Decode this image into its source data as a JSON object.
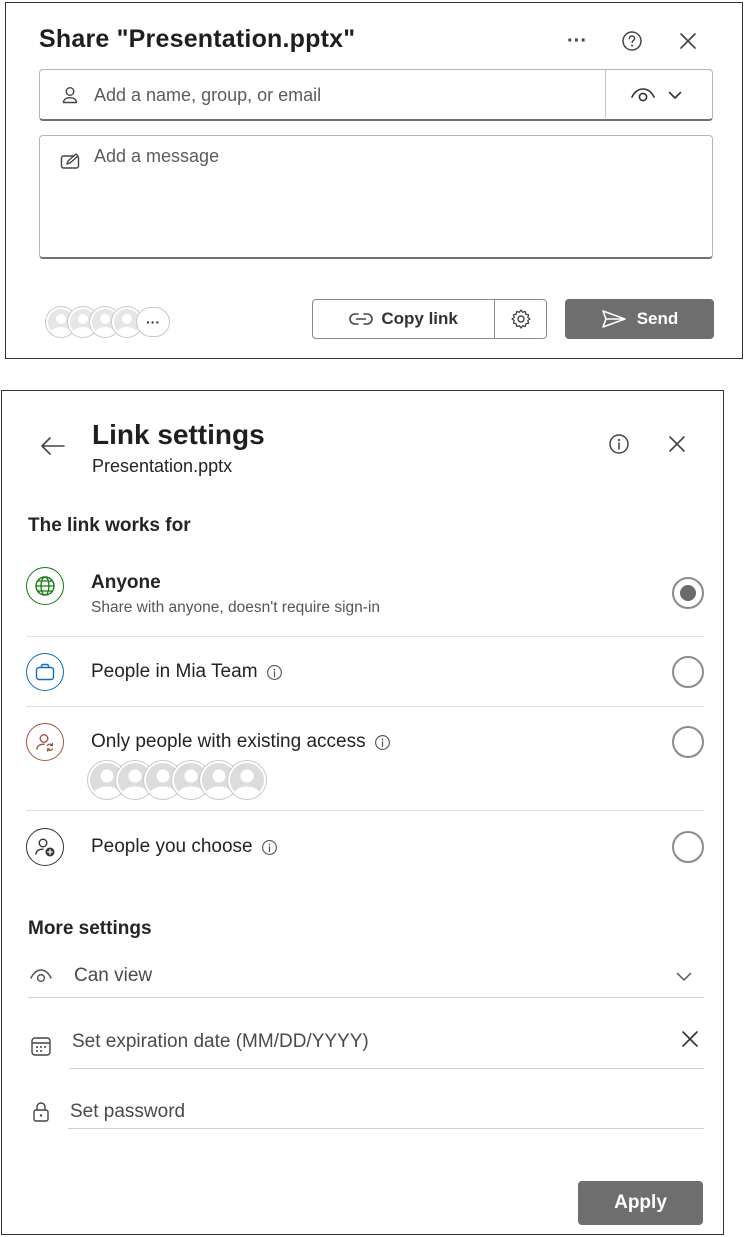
{
  "share": {
    "title": "Share \"Presentation.pptx\"",
    "more_label": "···",
    "recipient_placeholder": "Add a name, group, or email",
    "message_placeholder": "Add a message",
    "avatar_more_label": "···",
    "copy_link_label": "Copy link",
    "send_label": "Send",
    "icons": {
      "more": "more-horizontal-icon",
      "help": "question-circle-icon",
      "close": "close-icon",
      "recipient": "person-icon",
      "permission": "eye-icon",
      "permission_chevron": "chevron-down-icon",
      "message": "edit-message-icon",
      "copy": "link-icon",
      "settings": "gear-icon",
      "send": "send-icon"
    }
  },
  "link_settings": {
    "title": "Link settings",
    "subtitle": "Presentation.pptx",
    "works_for_heading": "The link works for",
    "options": [
      {
        "label": "Anyone",
        "description": "Share with anyone, doesn't require sign-in",
        "selected": true,
        "icon": "globe-icon",
        "color": "#107c10"
      },
      {
        "label": "People in Mia Team",
        "selected": false,
        "icon": "briefcase-icon",
        "color": "#0f6cbd"
      },
      {
        "label": "Only people with existing access",
        "selected": false,
        "icon": "person-sync-icon",
        "color": "#a4523b"
      },
      {
        "label": "People you choose",
        "selected": false,
        "icon": "person-add-icon",
        "color": "#333333"
      }
    ],
    "more_settings_heading": "More settings",
    "permission_value": "Can view",
    "expiration_placeholder": "Set expiration date (MM/DD/YYYY)",
    "password_placeholder": "Set password",
    "apply_label": "Apply"
  },
  "colors": {
    "button_gray": "#6e6e6e",
    "text": "#242424",
    "border": "#8a8a8a"
  }
}
